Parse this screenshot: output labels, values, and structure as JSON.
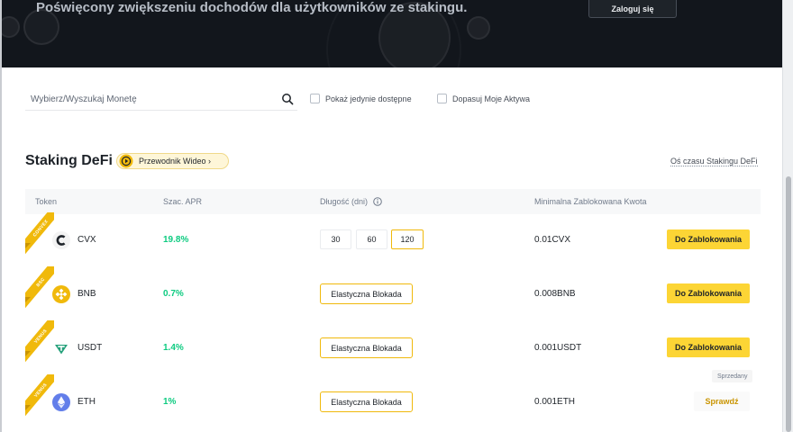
{
  "hero": {
    "title": "Poświęcony zwiększeniu dochodów dla użytkowników ze stakingu.",
    "login_label": "Zaloguj się"
  },
  "filters": {
    "search_placeholder": "Wybierz/Wyszukaj Monetę",
    "show_available_label": "Pokaż jedynie dostępne",
    "match_assets_label": "Dopasuj Moje Aktywa"
  },
  "section": {
    "title": "Staking DeFi",
    "video_guide_label": "Przewodnik Wideo ›",
    "timeline_link": "Oś czasu Stakingu DeFi"
  },
  "table": {
    "headers": {
      "token": "Token",
      "apr": "Szac. APR",
      "duration": "Długość (dni)",
      "min_amount": "Minimalna Zablokowana Kwota"
    },
    "rows": [
      {
        "ribbon": "CONVEX",
        "symbol": "CVX",
        "apr": "19.8%",
        "durations": [
          "30",
          "60",
          "120"
        ],
        "selected_duration": "120",
        "min_amount": "0.01CVX",
        "action": "Do Zablokowania"
      },
      {
        "ribbon": "BSC",
        "symbol": "BNB",
        "apr": "0.7%",
        "flexible_label": "Elastyczna Blokada",
        "min_amount": "0.008BNB",
        "action": "Do Zablokowania"
      },
      {
        "ribbon": "VENUS",
        "symbol": "USDT",
        "apr": "1.4%",
        "flexible_label": "Elastyczna Blokada",
        "min_amount": "0.001USDT",
        "action": "Do Zablokowania"
      },
      {
        "ribbon": "VENUS",
        "symbol": "ETH",
        "apr": "1%",
        "flexible_label": "Elastyczna Blokada",
        "min_amount": "0.001ETH",
        "badge": "Sprzedany",
        "action": "Sprawdź"
      }
    ]
  },
  "colors": {
    "accent": "#f0b90b",
    "button_yellow": "#fcd535",
    "apr_green": "#0ecb81",
    "hero_bg": "#12161c"
  }
}
